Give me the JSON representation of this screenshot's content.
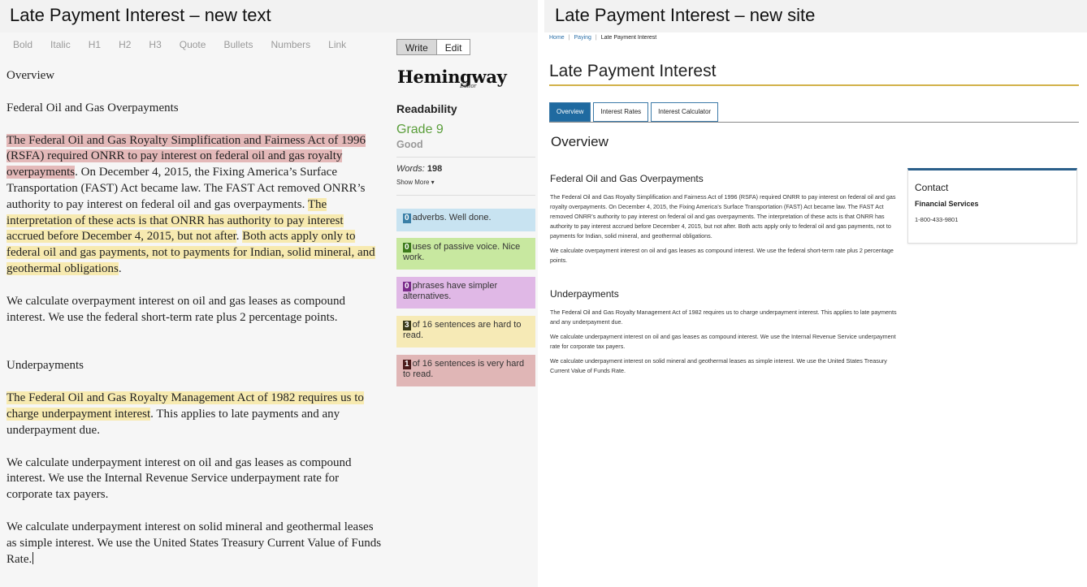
{
  "left": {
    "panel_title": "Late Payment Interest – new text",
    "toolbar": [
      "Bold",
      "Italic",
      "H1",
      "H2",
      "H3",
      "Quote",
      "Bullets",
      "Numbers",
      "Link"
    ],
    "mode": {
      "write": "Write",
      "edit": "Edit"
    },
    "logo": {
      "name": "Hemingway",
      "sub": "Editor"
    },
    "readability": {
      "label": "Readability",
      "grade": "Grade 9",
      "grade_note": "Good",
      "words_label": "Words:",
      "words_count": "198",
      "show_more": "Show More ▾"
    },
    "cards": [
      {
        "num": "0",
        "text": "adverbs. Well done."
      },
      {
        "num": "0",
        "text": "uses of passive voice. Nice work."
      },
      {
        "num": "0",
        "text": "phrases have simpler alternatives."
      },
      {
        "num": "3",
        "text": "of 16 sentences are hard to read."
      },
      {
        "num": "1",
        "text": "of 16 sentences is very hard to read."
      }
    ],
    "doc": {
      "h_overview": "Overview",
      "h_federal": "Federal Oil and Gas Overpayments",
      "p1_red": "The Federal Oil and Gas Royalty Simplification and Fairness Act of 1996 (RSFA) required ONRR to pay interest on federal oil and gas royalty overpayments",
      "p1_plain": ". On December 4, 2015, the Fixing America’s Surface Transportation (FAST) Act became law. The FAST Act removed ONRR’s authority to pay interest on federal oil and gas overpayments. ",
      "p1_yel1": "The interpretation of these acts is that ONRR has authority to pay interest accrued before December 4, 2015, but not after",
      "p1_dot": ". ",
      "p1_yel2": "Both acts apply only to federal oil and gas payments, not to payments for Indian, solid mineral, and geothermal obligations",
      "p1_end": ".",
      "p2": "We calculate overpayment interest on oil and gas leases as compound interest. We use the federal short-term rate plus 2 percentage points.",
      "h_under": "Underpayments",
      "p3_yel": "The Federal Oil and Gas Royalty Management Act of 1982 requires us to charge underpayment interest",
      "p3_plain": ". This applies to late payments and any underpayment due.",
      "p4": "We calculate underpayment interest on oil and gas leases as compound interest. We use the Internal Revenue Service underpayment rate for corporate tax payers.",
      "p5": "We calculate underpayment interest on solid mineral and geothermal leases as simple interest. We use the United States Treasury Current Value of Funds Rate."
    }
  },
  "right": {
    "panel_title": "Late Payment Interest – new site",
    "breadcrumb": {
      "home": "Home",
      "paying": "Paying",
      "current": "Late Payment Interest"
    },
    "page_title": "Late Payment Interest",
    "tabs": [
      "Overview",
      "Interest Rates",
      "Interest Calculator"
    ],
    "section_title": "Overview",
    "h_federal": "Federal Oil and Gas Overpayments",
    "p1": "The Federal Oil and Gas Royalty Simplification and Fairness Act of 1996 (RSFA) required ONRR to pay interest on federal oil and gas royalty overpayments. On December 4, 2015, the Fixing America’s Surface Transportation (FAST) Act became law. The FAST Act removed ONRR’s authority to pay interest on federal oil and gas overpayments. The interpretation of these acts is that ONRR has authority to pay interest accrued before December 4, 2015, but not after. Both acts apply only to federal oil and gas payments, not to payments for Indian, solid mineral, and geothermal obligations.",
    "p2": "We calculate overpayment interest on oil and gas leases as compound interest. We use the federal short-term rate plus 2 percentage points.",
    "h_under": "Underpayments",
    "p3": "The Federal Oil and Gas Royalty Management Act of 1982 requires us to charge underpayment interest. This applies to late payments and any underpayment due.",
    "p4": "We calculate underpayment interest on oil and gas leases as compound interest. We use the Internal Revenue Service underpayment rate for corporate tax payers.",
    "p5": "We calculate underpayment interest on solid mineral and geothermal leases as simple interest. We use the United States Treasury Current Value of Funds Rate.",
    "contact": {
      "title": "Contact",
      "org": "Financial Services",
      "phone": "1-800-433-9801"
    }
  }
}
